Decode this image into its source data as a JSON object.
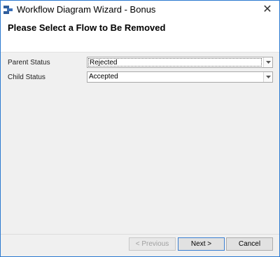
{
  "window": {
    "title": "Workflow Diagram Wizard - Bonus",
    "close_glyph": "✕"
  },
  "header": {
    "title": "Please Select a Flow to Be Removed"
  },
  "form": {
    "parent_status": {
      "label": "Parent Status",
      "value": "Rejected"
    },
    "child_status": {
      "label": "Child Status",
      "value": "Accepted"
    }
  },
  "footer": {
    "previous_label": "< Previous",
    "next_label": "Next >",
    "cancel_label": "Cancel"
  },
  "icons": {
    "app": "workflow-app-icon",
    "close": "close-icon",
    "dropdown": "chevron-down-icon"
  },
  "colors": {
    "window_border": "#2b79d0",
    "default_button_border": "#3b7fd1"
  }
}
